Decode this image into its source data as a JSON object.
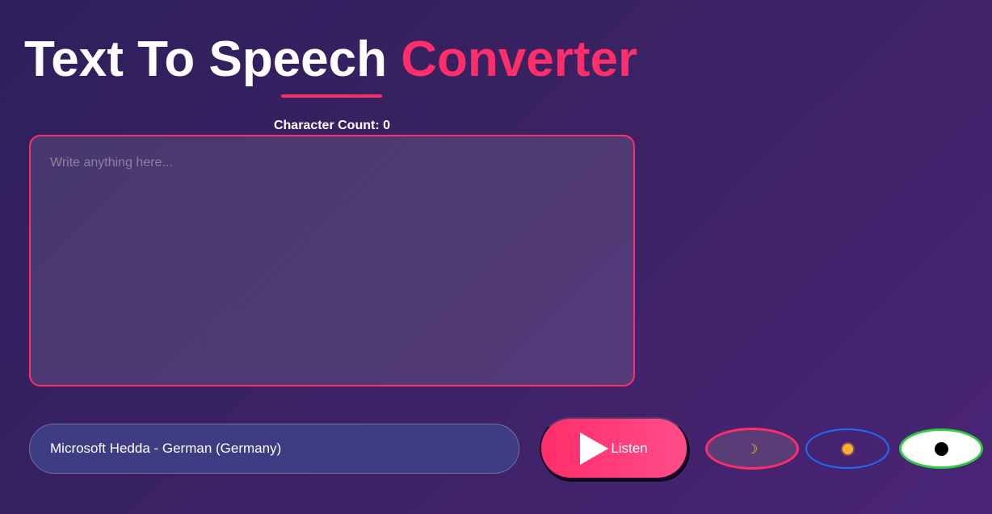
{
  "header": {
    "title_main": "Text To Speech",
    "title_accent": "Converter"
  },
  "editor": {
    "char_count_label": "Character Count:",
    "char_count_value": "0",
    "placeholder": "Write anything here...",
    "value": ""
  },
  "controls": {
    "voice_selected": "Microsoft Hedda - German (Germany)",
    "listen_label": "Listen"
  },
  "theme_buttons": [
    {
      "name": "dark",
      "icon": "moon-icon"
    },
    {
      "name": "light",
      "icon": "sun-icon"
    },
    {
      "name": "contrast",
      "icon": "dot-icon"
    }
  ],
  "colors": {
    "accent": "#ff2d6a",
    "background": "#3a2263",
    "light_theme_border": "#1f6cff",
    "contrast_theme_border": "#2ecc40"
  }
}
